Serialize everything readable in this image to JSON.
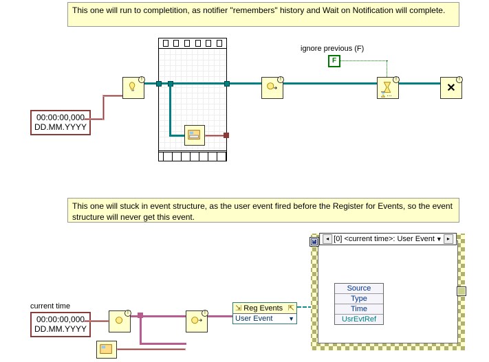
{
  "comments": {
    "top": "This one will run to completition, as notifier \"remembers\" history and Wait on Notification will complete.",
    "bottom": "This one will stuck in event structure, as the user event fired before the Register for Events, so the event structure will never get this event."
  },
  "timestamp": {
    "time": "00:00:00,000",
    "date": "DD.MM.YYYY"
  },
  "labels": {
    "ignore_previous": "ignore previous (F)",
    "current_time": "current time",
    "bool_f": "F"
  },
  "event_structure": {
    "header_case": "[0] <current time>: User Event",
    "data_fields": [
      "Source",
      "Type",
      "Time",
      "UsrEvtRef"
    ]
  },
  "reg_events": {
    "title": "Reg Events",
    "row": "User Event"
  },
  "icons": {
    "obtain_notifier": "lightbulb-exclaim-icon",
    "send_notification": "lightbulb-arrow-icon",
    "wait_notification": "hourglass-exclaim-icon",
    "release_notifier": "x-exclaim-icon",
    "subvi": "panel-icon",
    "create_user_event": "lightbulb-exclaim-icon",
    "generate_user_event": "lightbulb-arrow-icon"
  }
}
